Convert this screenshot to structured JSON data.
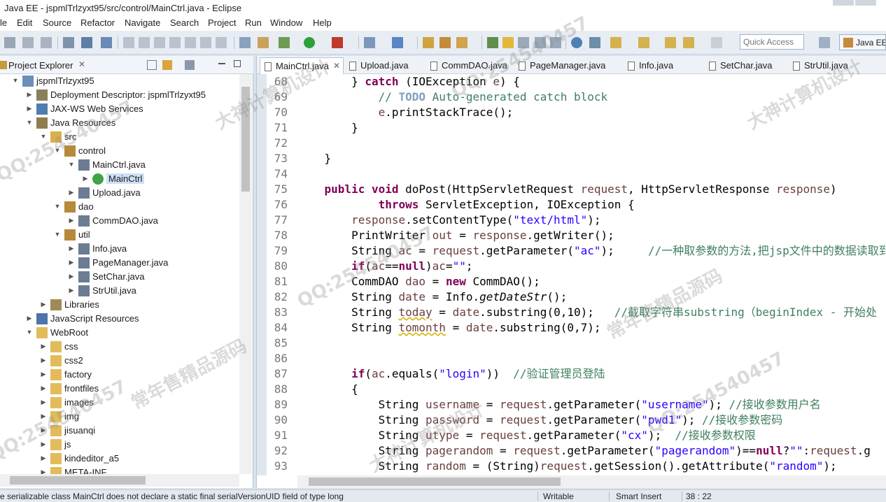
{
  "window": {
    "title": "Java EE - jspmlTrlzyxt95/src/control/MainCtrl.java - Eclipse"
  },
  "menubar": {
    "items": [
      "le",
      "Edit",
      "Source",
      "Refactor",
      "Navigate",
      "Search",
      "Project",
      "Run",
      "Window",
      "Help"
    ]
  },
  "toolbar": {
    "quick_access_placeholder": "Quick Access",
    "perspective_label": "Java EE"
  },
  "explorer": {
    "title": "Project Explorer",
    "tree": [
      {
        "label": "jspmlTrlzyxt95",
        "icon": "project-icon",
        "expanded": true
      },
      {
        "label": "Deployment Descriptor: jspmlTrlzyxt95",
        "icon": "descriptor-icon",
        "expanded": false
      },
      {
        "label": "JAX-WS Web Services",
        "icon": "webservice-icon",
        "expanded": false
      },
      {
        "label": "Java Resources",
        "icon": "java-resources-icon",
        "expanded": true
      },
      {
        "label": "src",
        "icon": "source-folder-icon",
        "expanded": true
      },
      {
        "label": "control",
        "icon": "package-icon",
        "expanded": true
      },
      {
        "label": "MainCtrl.java",
        "icon": "java-file-icon",
        "expanded": true
      },
      {
        "label": "MainCtrl",
        "icon": "class-icon",
        "expanded": false,
        "selected": true
      },
      {
        "label": "Upload.java",
        "icon": "java-file-icon",
        "expanded": false
      },
      {
        "label": "dao",
        "icon": "package-icon",
        "expanded": true
      },
      {
        "label": "CommDAO.java",
        "icon": "java-file-icon",
        "expanded": false
      },
      {
        "label": "util",
        "icon": "package-icon",
        "expanded": true
      },
      {
        "label": "Info.java",
        "icon": "java-file-icon",
        "expanded": false
      },
      {
        "label": "PageManager.java",
        "icon": "java-file-icon",
        "expanded": false
      },
      {
        "label": "SetChar.java",
        "icon": "java-file-icon",
        "expanded": false
      },
      {
        "label": "StrUtil.java",
        "icon": "java-file-icon",
        "expanded": false
      },
      {
        "label": "Libraries",
        "icon": "library-icon",
        "expanded": false
      },
      {
        "label": "JavaScript Resources",
        "icon": "javascript-icon",
        "expanded": false
      },
      {
        "label": "WebRoot",
        "icon": "folder-icon",
        "expanded": true
      },
      {
        "label": "css",
        "icon": "folder-icon",
        "expanded": false
      },
      {
        "label": "css2",
        "icon": "folder-icon",
        "expanded": false
      },
      {
        "label": "factory",
        "icon": "folder-icon",
        "expanded": false
      },
      {
        "label": "frontfiles",
        "icon": "folder-icon",
        "expanded": false
      },
      {
        "label": "images",
        "icon": "folder-icon",
        "expanded": false
      },
      {
        "label": "img",
        "icon": "folder-icon",
        "expanded": false
      },
      {
        "label": "jisuanqi",
        "icon": "folder-icon",
        "expanded": false
      },
      {
        "label": "js",
        "icon": "folder-icon",
        "expanded": false
      },
      {
        "label": "kindeditor_a5",
        "icon": "folder-icon",
        "expanded": false
      },
      {
        "label": "META-INF",
        "icon": "folder-icon",
        "expanded": false
      }
    ]
  },
  "editor": {
    "tabs": [
      "MainCtrl.java",
      "Upload.java",
      "CommDAO.java",
      "PageManager.java",
      "Info.java",
      "SetChar.java",
      "StrUtil.java"
    ],
    "active_tab": "MainCtrl.java",
    "line_numbers": [
      "68",
      "69",
      "70",
      "71",
      "72",
      "73",
      "74",
      "75",
      "76",
      "77",
      "78",
      "79",
      "80",
      "81",
      "82",
      "83",
      "84",
      "85",
      "86",
      "87",
      "88",
      "89",
      "90",
      "91",
      "92",
      "93"
    ]
  },
  "status": {
    "message": "e serializable class MainCtrl does not declare a static final serialVersionUID field of type long",
    "mode": "Writable",
    "insert": "Smart Insert",
    "position": "38 : 22"
  },
  "watermark": {
    "texts": [
      "QQ:254540457",
      "大神计算机设计",
      "常年售精品源码"
    ]
  },
  "colors": {
    "keyword": "#7f0055",
    "string": "#2a00ff",
    "comment": "#3f7f5f",
    "todo": "#7f9fbf",
    "selection": "#cde0f6"
  }
}
